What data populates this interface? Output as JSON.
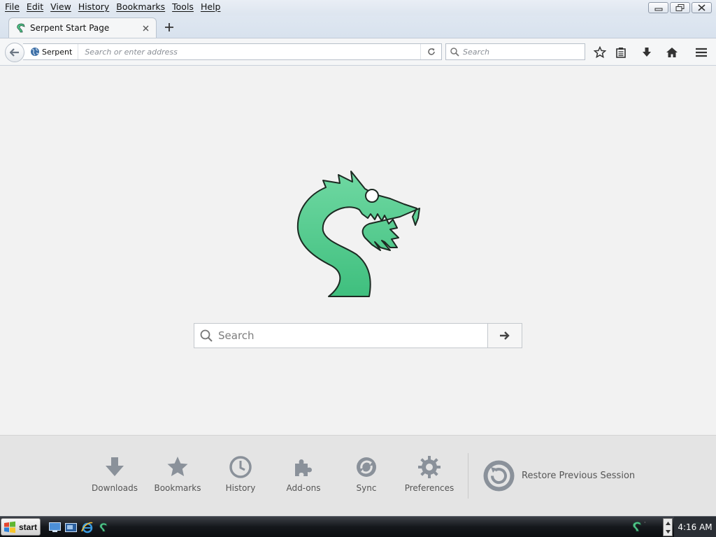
{
  "menubar": {
    "items": [
      "File",
      "Edit",
      "View",
      "History",
      "Bookmarks",
      "Tools",
      "Help"
    ]
  },
  "window_controls": [
    "minimize-icon",
    "restore-icon",
    "close-icon"
  ],
  "tabs": [
    {
      "title": "Serpent Start Page",
      "favicon": "serpent-icon",
      "active": true
    }
  ],
  "navbar": {
    "site_identity_label": "Serpent",
    "address_placeholder": "Search or enter address",
    "search_placeholder": "Search",
    "icons": [
      "back-icon",
      "globe-icon",
      "reload-icon",
      "search-icon",
      "star-icon",
      "reading-list-icon",
      "download-icon",
      "home-icon",
      "menu-icon"
    ]
  },
  "main": {
    "search_placeholder": "Search",
    "logo_color": "#50c88a"
  },
  "launcher": {
    "items": [
      {
        "label": "Downloads",
        "icon": "download-icon"
      },
      {
        "label": "Bookmarks",
        "icon": "star-icon"
      },
      {
        "label": "History",
        "icon": "clock-icon"
      },
      {
        "label": "Add-ons",
        "icon": "puzzle-icon"
      },
      {
        "label": "Sync",
        "icon": "sync-icon"
      },
      {
        "label": "Preferences",
        "icon": "gear-icon"
      }
    ],
    "restore_label": "Restore Previous Session",
    "icon_color": "#8a919a"
  },
  "taskbar": {
    "start_label": "start",
    "clock": "4:16 AM"
  }
}
